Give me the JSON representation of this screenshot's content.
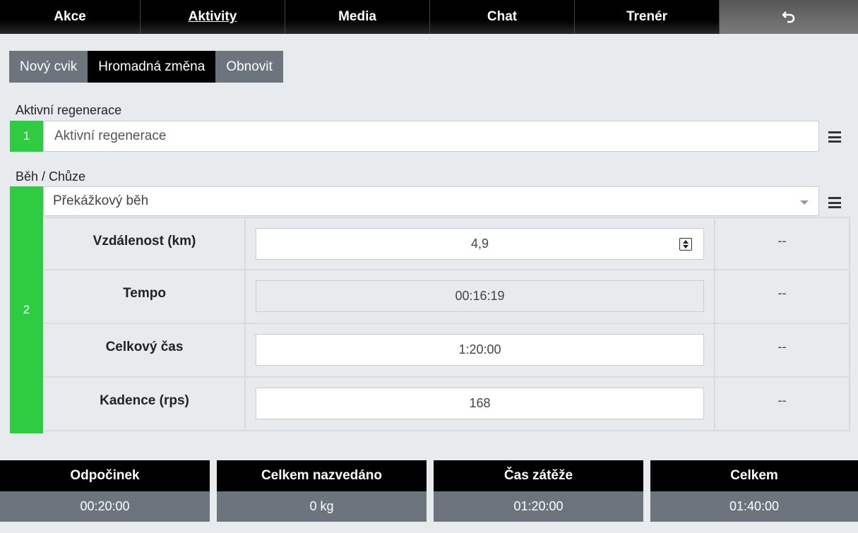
{
  "nav": {
    "tabs": [
      {
        "label": "Akce"
      },
      {
        "label": "Aktivity"
      },
      {
        "label": "Media"
      },
      {
        "label": "Chat"
      },
      {
        "label": "Trenér"
      }
    ],
    "back_icon": "undo-arrow-icon"
  },
  "toolbar": {
    "new_exercise": "Nový cvik",
    "bulk_change": "Hromadná změna",
    "refresh": "Obnovit"
  },
  "exercises": [
    {
      "section_label": "Aktivní regenerace",
      "number": "1",
      "value": "Aktivní regenerace"
    },
    {
      "section_label": "Běh / Chůze",
      "number": "2",
      "selected": "Překážkový běh",
      "params": [
        {
          "label": "Vzdálenost (km)",
          "value": "4,9",
          "extra": "--"
        },
        {
          "label": "Tempo",
          "value": "00:16:19",
          "extra": "--"
        },
        {
          "label": "Celkový čas",
          "value": "1:20:00",
          "extra": "--"
        },
        {
          "label": "Kadence (rps)",
          "value": "168",
          "extra": "--"
        }
      ]
    }
  ],
  "summary": [
    {
      "label": "Odpočinek",
      "value": "00:20:00"
    },
    {
      "label": "Celkem nazvedáno",
      "value": "0 kg"
    },
    {
      "label": "Čas zátěže",
      "value": "01:20:00"
    },
    {
      "label": "Celkem",
      "value": "01:40:00"
    }
  ],
  "colors": {
    "accent_green": "#2ecc40",
    "button_grey": "#6c757d",
    "background": "#e8ebee"
  }
}
